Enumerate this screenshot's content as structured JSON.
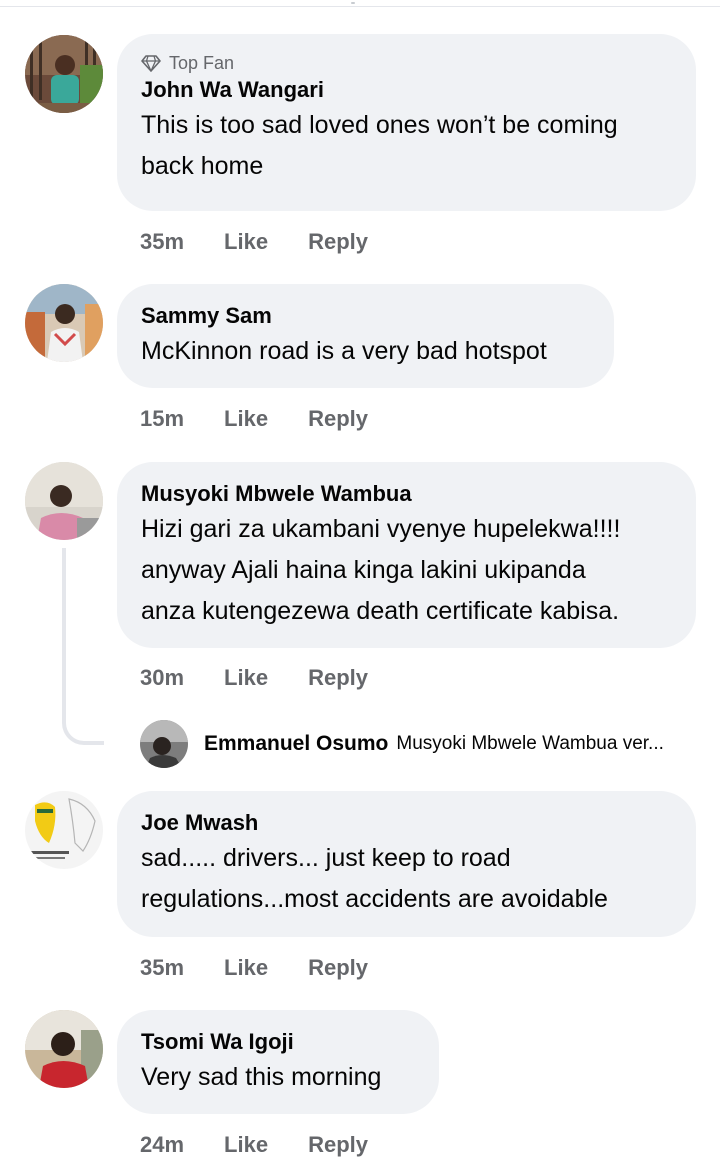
{
  "comments": [
    {
      "badge": "Top Fan",
      "author": "John Wa Wangari",
      "lines": [
        "This is too sad loved ones won’t be coming",
        "back home"
      ],
      "time": "35m",
      "like": "Like",
      "reply": "Reply"
    },
    {
      "author": "Sammy Sam",
      "lines": [
        "McKinnon road is a very bad hotspot"
      ],
      "time": "15m",
      "like": "Like",
      "reply": "Reply"
    },
    {
      "author": "Musyoki Mbwele Wambua",
      "lines": [
        "Hizi gari za ukambani vyenye hupelekwa!!!!",
        "anyway Ajali haina kinga lakini ukipanda",
        "anza kutengezewa death certificate kabisa."
      ],
      "time": "30m",
      "like": "Like",
      "reply": "Reply"
    },
    {
      "author": "Joe Mwash",
      "lines": [
        "sad..... drivers... just keep to road",
        "regulations...most accidents are avoidable"
      ],
      "time": "35m",
      "like": "Like",
      "reply": "Reply"
    },
    {
      "author": "Tsomi Wa Igoji",
      "lines": [
        "Very sad this morning"
      ],
      "time": "24m",
      "like": "Like",
      "reply": "Reply"
    }
  ],
  "reply_preview": {
    "author": "Emmanuel Osumo",
    "text": "Musyoki Mbwele Wambua ver..."
  },
  "icons": {
    "top_fan": "diamond-icon"
  },
  "colors": {
    "bubble": "#f0f2f5",
    "secondary_text": "#65676b",
    "primary_text": "#050505"
  }
}
